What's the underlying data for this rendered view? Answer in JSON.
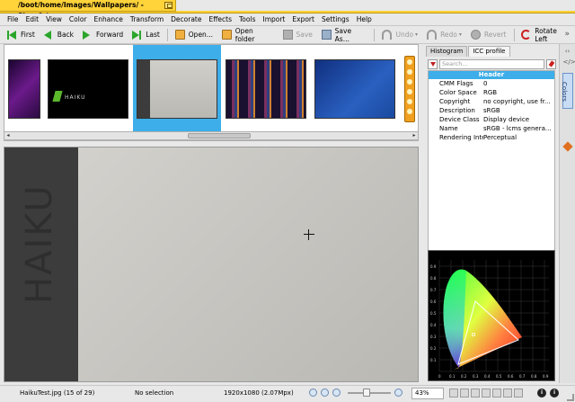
{
  "window": {
    "title": "/boot/home/Images/Wallpapers/ - Showfoto"
  },
  "menu": [
    "File",
    "Edit",
    "View",
    "Color",
    "Enhance",
    "Transform",
    "Decorate",
    "Effects",
    "Tools",
    "Import",
    "Export",
    "Settings",
    "Help"
  ],
  "toolbar": {
    "first": "First",
    "back": "Back",
    "forward": "Forward",
    "last": "Last",
    "open": "Open...",
    "open_folder": "Open folder",
    "save": "Save",
    "save_as": "Save As...",
    "undo": "Undo",
    "redo": "Redo",
    "revert": "Revert",
    "rotate_left": "Rotate Left"
  },
  "thumbnails": {
    "selected_index": 2,
    "items": [
      {
        "colors": [
          "#2a0a40",
          "#6b1a8a",
          "#1a0530"
        ]
      },
      {
        "colors": [
          "#000000",
          "#0a0a0a",
          "#1a1a1a"
        ],
        "logo": "HAIKU"
      },
      {
        "colors": [
          "#c8c7c2",
          "#bdbcb6",
          "#a8a7a0"
        ]
      },
      {
        "colors": [
          "#1a1030",
          "#7a3060",
          "#203060"
        ]
      },
      {
        "colors": [
          "#1a4aa0",
          "#2a60c0",
          "#103080"
        ]
      }
    ]
  },
  "canvas": {
    "vertical_text": "HAIKU"
  },
  "panel": {
    "tabs": [
      "Histogram",
      "ICC profile"
    ],
    "active_tab": 1,
    "search_placeholder": "Search...",
    "header": "Header",
    "rows": [
      {
        "key": "CMM Flags",
        "value": "0"
      },
      {
        "key": "Color Space",
        "value": "RGB"
      },
      {
        "key": "Copyright",
        "value": "no copyright, use fr..."
      },
      {
        "key": "Description",
        "value": "sRGB"
      },
      {
        "key": "Device Class",
        "value": "Display device"
      },
      {
        "key": "Name",
        "value": "sRGB - lcms genera..."
      },
      {
        "key": "Rendering Intent",
        "value": "Perceptual"
      }
    ],
    "side_tab": "Colors",
    "cie_axis_x": [
      "0",
      "0.1",
      "0.2",
      "0.3",
      "0.4",
      "0.5",
      "0.6",
      "0.7",
      "0.8",
      "0.9"
    ],
    "cie_axis_y": [
      "0.9",
      "0.8",
      "0.7",
      "0.6",
      "0.5",
      "0.4",
      "0.3",
      "0.2",
      "0.1"
    ]
  },
  "status": {
    "file": "HaikuTest.jpg (15 of 29)",
    "selection": "No selection",
    "size": "1920x1080 (2.07Mpx)",
    "zoom": "43%",
    "zoom_fraction": 0.43
  },
  "colors": {
    "title_tab": "#ffd33a",
    "selection": "#3daee9",
    "nav_green": "#2aa62a"
  }
}
